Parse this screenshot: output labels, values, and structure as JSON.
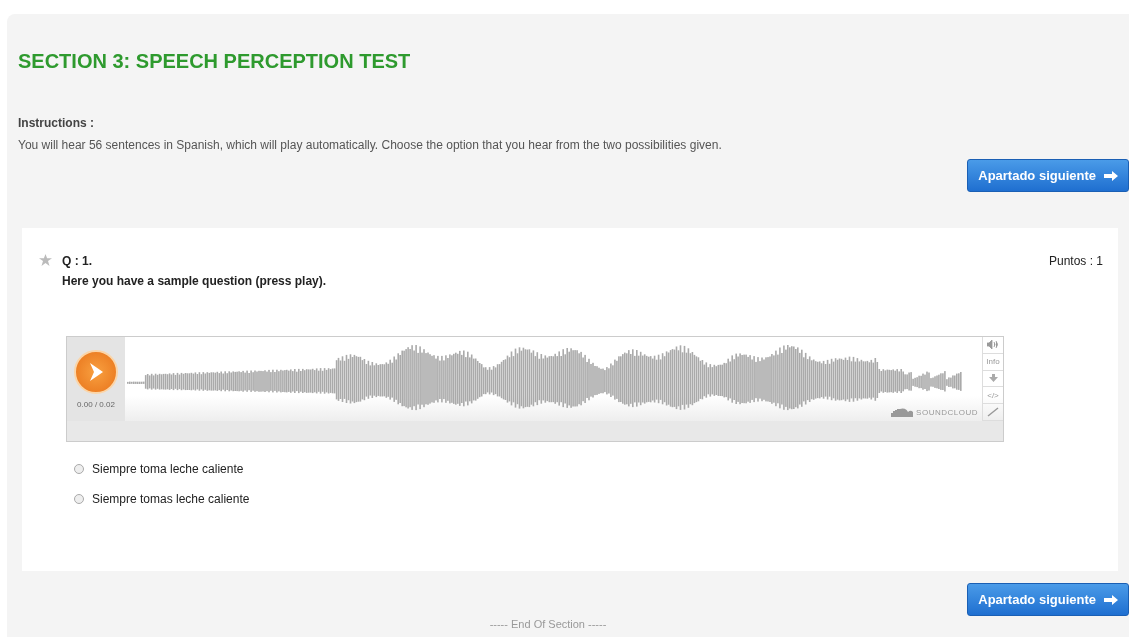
{
  "section_title": "SECTION 3: SPEECH PERCEPTION TEST",
  "instructions": {
    "label": "Instructions :",
    "text": "You will hear 56 sentences in Spanish, which will play automatically. Choose the option that you hear from the two possibilities given."
  },
  "top_button": {
    "label": "Apartado siguiente"
  },
  "question": {
    "number": "Q : 1.",
    "prompt": "Here you have a sample question (press play).",
    "points": "Puntos : 1",
    "player": {
      "time": "0.00 / 0.02",
      "info_label": "Info",
      "embed_label": "</>",
      "brand": "SOUNDCLOUD"
    },
    "options": [
      {
        "label": "Siempre toma leche caliente",
        "selected": false
      },
      {
        "label": "Siempre tomas leche caliente",
        "selected": false
      }
    ]
  },
  "bottom_button": {
    "label": "Apartado siguiente"
  },
  "footer": "----- End Of Section -----"
}
